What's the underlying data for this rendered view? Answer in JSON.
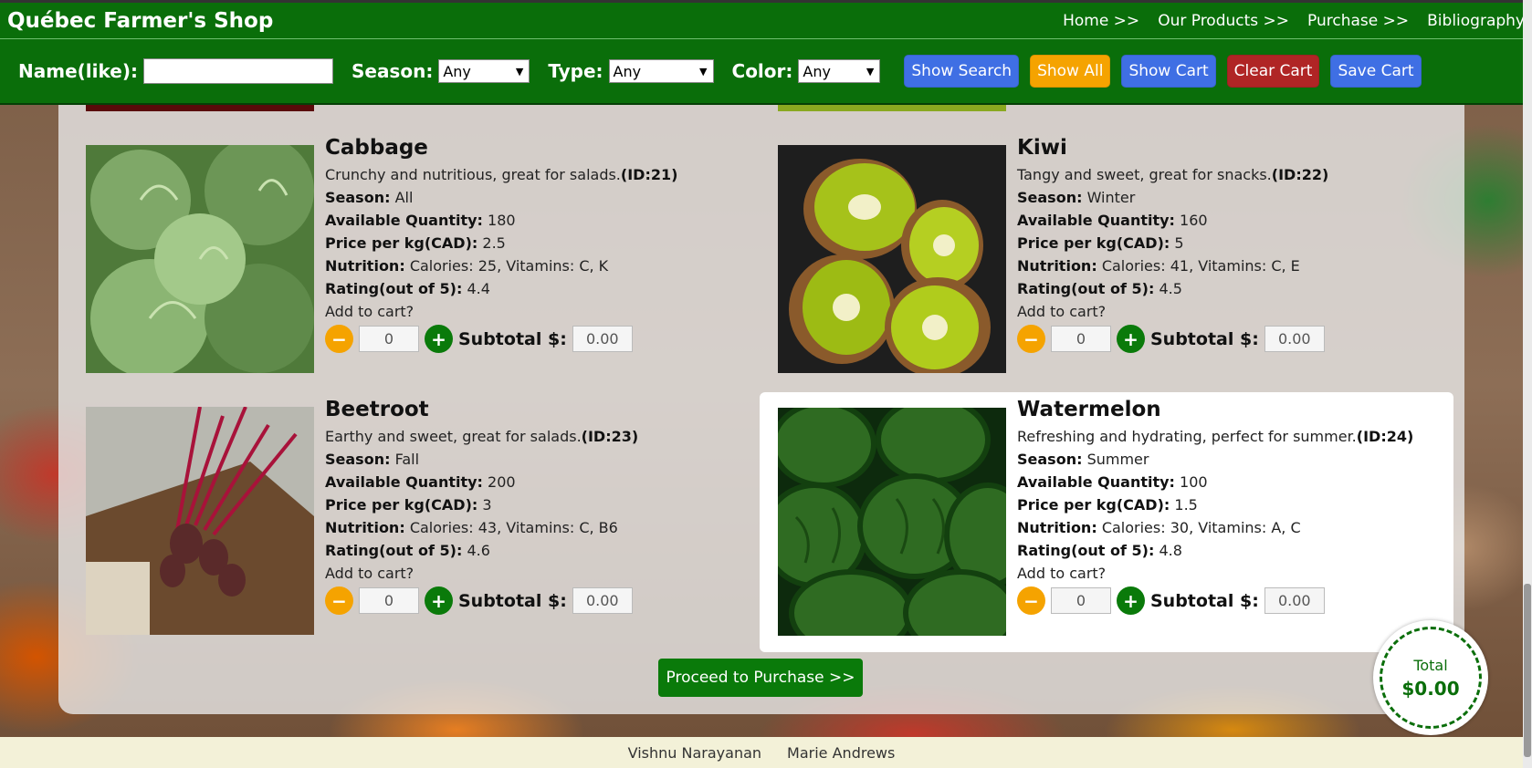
{
  "header": {
    "brand": "Québec Farmer's Shop",
    "nav": [
      "Home >>",
      "Our Products >>",
      "Purchase >>",
      "Bibliography"
    ]
  },
  "search": {
    "name_label": "Name(like):",
    "name_value": "",
    "season_label": "Season:",
    "season_value": "Any",
    "type_label": "Type:",
    "type_value": "Any",
    "color_label": "Color:",
    "color_value": "Any",
    "buttons": {
      "show_search": "Show Search",
      "show_all": "Show All",
      "show_cart": "Show Cart",
      "clear_cart": "Clear Cart",
      "save_cart": "Save Cart"
    }
  },
  "products": [
    {
      "name": "Cabbage",
      "desc": "Crunchy and nutritious, great for salads.",
      "id": "(ID:21)",
      "season": "All",
      "quantity": "180",
      "price": "2.5",
      "nutrition": "Calories: 25, Vitamins: C, K",
      "rating": "4.4",
      "qty": "0",
      "subtotal": "0.00",
      "image": "cabbage"
    },
    {
      "name": "Kiwi",
      "desc": "Tangy and sweet, great for snacks.",
      "id": "(ID:22)",
      "season": "Winter",
      "quantity": "160",
      "price": "5",
      "nutrition": "Calories: 41, Vitamins: C, E",
      "rating": "4.5",
      "qty": "0",
      "subtotal": "0.00",
      "image": "kiwi"
    },
    {
      "name": "Beetroot",
      "desc": "Earthy and sweet, great for salads.",
      "id": "(ID:23)",
      "season": "Fall",
      "quantity": "200",
      "price": "3",
      "nutrition": "Calories: 43, Vitamins: C, B6",
      "rating": "4.6",
      "qty": "0",
      "subtotal": "0.00",
      "image": "beetroot"
    },
    {
      "name": "Watermelon",
      "desc": "Refreshing and hydrating, perfect for summer.",
      "id": "(ID:24)",
      "season": "Summer",
      "quantity": "100",
      "price": "1.5",
      "nutrition": "Calories: 30, Vitamins: A, C",
      "rating": "4.8",
      "qty": "0",
      "subtotal": "0.00",
      "image": "watermelon"
    }
  ],
  "labels": {
    "season": "Season:",
    "quantity": "Available Quantity:",
    "price": "Price per kg(CAD):",
    "nutrition": "Nutrition:",
    "rating": "Rating(out of 5):",
    "add_to_cart": "Add to cart?",
    "subtotal": "Subtotal $:",
    "minus": "−",
    "plus": "+"
  },
  "proceed_label": "Proceed to Purchase >>",
  "total": {
    "label": "Total",
    "value": "$0.00"
  },
  "footer": [
    "Vishnu Narayanan",
    "Marie Andrews"
  ]
}
